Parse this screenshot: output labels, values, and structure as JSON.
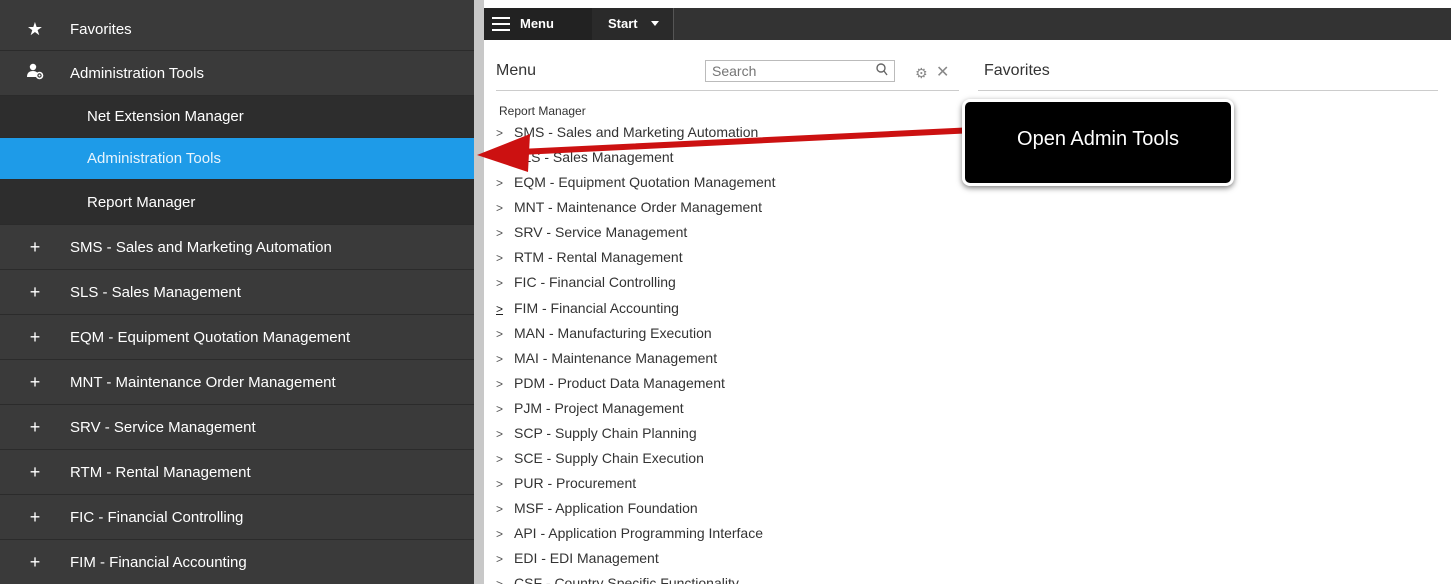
{
  "sidebar": {
    "favorites": "Favorites",
    "admin_tools": "Administration Tools",
    "sub_items": [
      "Net Extension Manager",
      "Administration Tools"
    ],
    "report_manager": "Report Manager",
    "modules": [
      "SMS - Sales and Marketing Automation",
      "SLS - Sales Management",
      "EQM - Equipment Quotation Management",
      "MNT - Maintenance Order Management",
      "SRV - Service Management",
      "RTM - Rental Management",
      "FIC - Financial Controlling",
      "FIM - Financial Accounting"
    ],
    "plus_symbol": "+"
  },
  "topbar": {
    "menu_label": "Menu",
    "start_label": "Start"
  },
  "menu_panel": {
    "title": "Menu",
    "search_placeholder": "Search",
    "report_heading": "Report Manager",
    "items": [
      "SMS - Sales and Marketing Automation",
      "SLS - Sales Management",
      "EQM - Equipment Quotation Management",
      "MNT - Maintenance Order Management",
      "SRV - Service Management",
      "RTM - Rental Management",
      "FIC - Financial Controlling",
      "FIM - Financial Accounting",
      "MAN - Manufacturing Execution",
      "MAI - Maintenance Management",
      "PDM - Product Data Management",
      "PJM - Project Management",
      "SCP - Supply Chain Planning",
      "SCE - Supply Chain Execution",
      "PUR - Procurement",
      "MSF - Application Foundation",
      "API - Application Programming Interface",
      "EDI - EDI Management",
      "CSF - Country Specific Functionality"
    ]
  },
  "favorites_panel": {
    "title": "Favorites"
  },
  "callout": {
    "text": "Open Admin Tools"
  },
  "colors": {
    "sidebar_bg": "#3a3a3a",
    "active_item": "#1e9be8",
    "arrow": "#cc1111"
  }
}
